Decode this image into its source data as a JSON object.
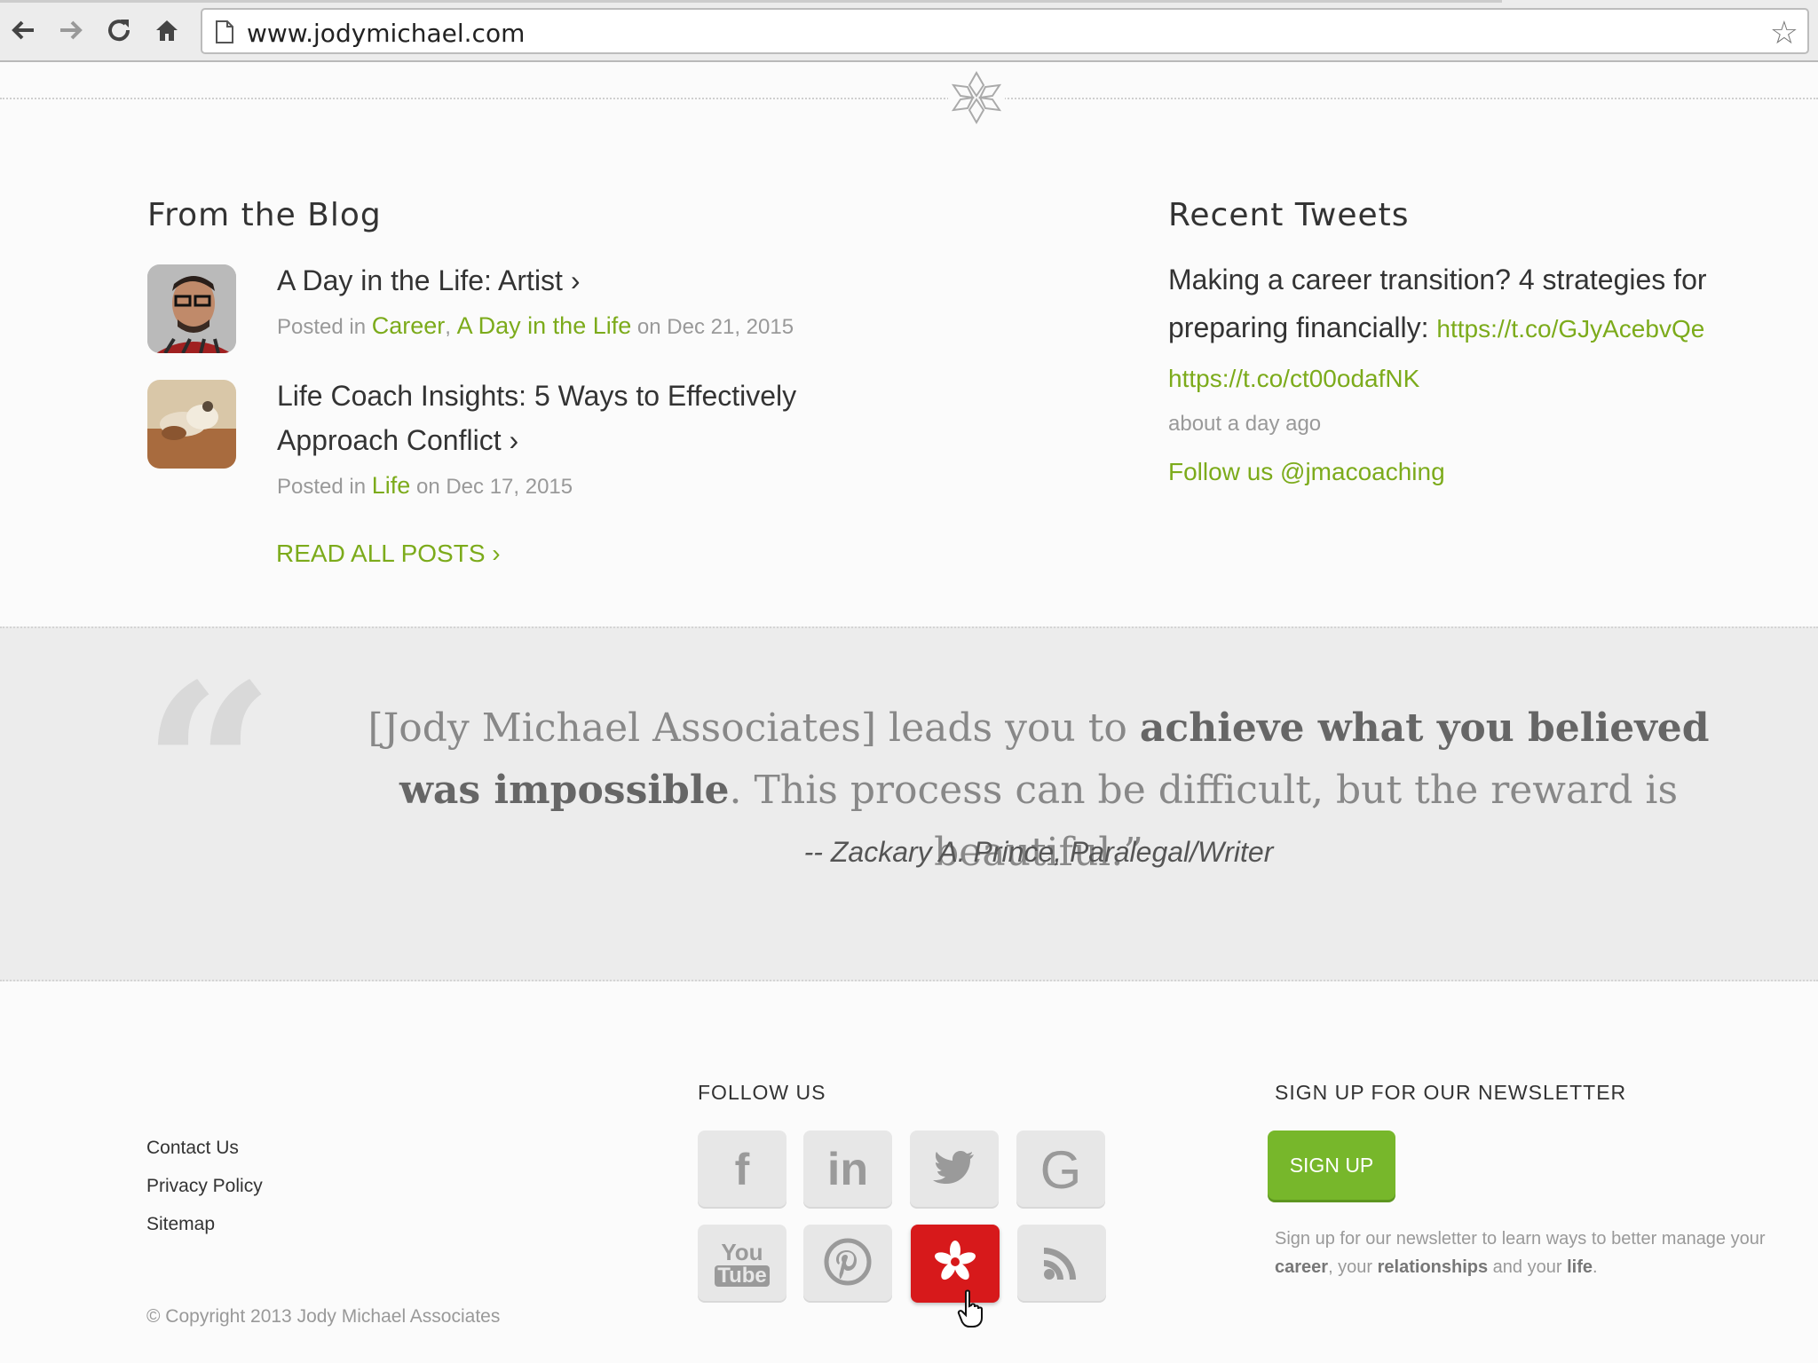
{
  "browser": {
    "url": "www.jodymichael.com",
    "icons": [
      "back-icon",
      "forward-icon",
      "reload-icon",
      "home-icon",
      "page-icon",
      "bookmark-star-icon"
    ]
  },
  "blog": {
    "title": "From the Blog",
    "posts": [
      {
        "title": "A Day in the Life: Artist ›",
        "posted_in_label": "Posted in",
        "categories": [
          "Career",
          "A Day in the Life"
        ],
        "category_separator": ",",
        "date_prefix": "on",
        "date": "Dec 21, 2015"
      },
      {
        "title_line1": "Life Coach Insights: 5 Ways to Effectively",
        "title_line2": "Approach Conflict ›",
        "posted_in_label": "Posted in",
        "categories": [
          "Life"
        ],
        "date_prefix": "on",
        "date": "Dec 17, 2015"
      }
    ],
    "read_all": "READ ALL POSTS ›"
  },
  "tweets": {
    "title": "Recent Tweets",
    "text_line1": "Making a career transition? 4 strategies for",
    "text_line2": "preparing financially:",
    "link1": "https://t.co/GJyAcebvQe",
    "link2": "https://t.co/ct00odafNK",
    "time": "about a day ago",
    "follow": "Follow us @jmacoaching"
  },
  "quote": {
    "part1": "[Jody Michael Associates] leads you to ",
    "bold1": "achieve what you believed was impossible",
    "part2": ". This process can be difficult, but the reward is beautiful.”",
    "author": "-- Zackary A. Prince, Paralegal/Writer"
  },
  "footer": {
    "links": [
      "Contact Us",
      "Privacy Policy",
      "Sitemap"
    ],
    "copyright": "© Copyright 2013 Jody Michael Associates",
    "follow_heading": "FOLLOW US",
    "social": [
      {
        "name": "facebook",
        "glyph": "f"
      },
      {
        "name": "linkedin",
        "glyph": "in"
      },
      {
        "name": "twitter",
        "glyph": ""
      },
      {
        "name": "google",
        "glyph": "G"
      },
      {
        "name": "youtube",
        "glyph_top": "You",
        "glyph_bottom": "Tube"
      },
      {
        "name": "pinterest",
        "glyph": ""
      },
      {
        "name": "yelp",
        "glyph": ""
      },
      {
        "name": "rss",
        "glyph": ""
      }
    ],
    "newsletter_heading": "SIGN UP FOR OUR NEWSLETTER",
    "signup_button": "SIGN UP",
    "signup_desc_1": "Sign up for our newsletter to learn ways to better manage your ",
    "signup_bold_1": "career",
    "signup_desc_2": ", your ",
    "signup_bold_2": "relationships",
    "signup_desc_3": " and your ",
    "signup_bold_3": "life",
    "signup_desc_4": "."
  },
  "colors": {
    "accent_green": "#7cab1b",
    "button_green": "#77b72b",
    "yelp_red": "#d7191b"
  }
}
